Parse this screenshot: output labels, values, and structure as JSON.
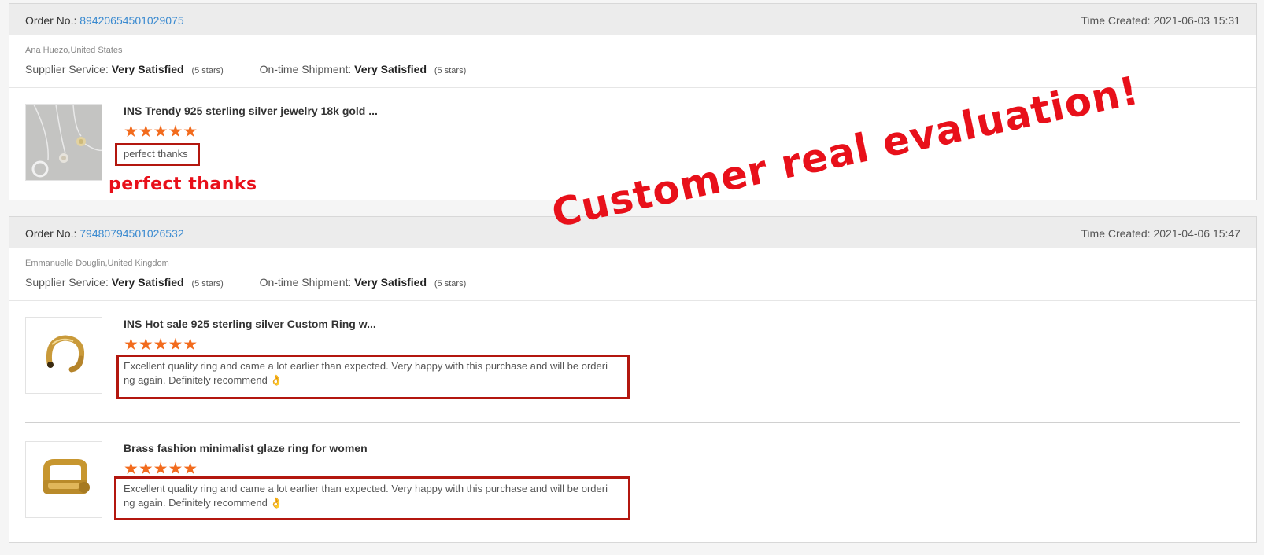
{
  "orders": [
    {
      "order_no_label": "Order No.:",
      "order_no": "89420654501029075",
      "time_created": "Time Created: 2021-06-03 15:31",
      "buyer": "Ana Huezo,United States",
      "supplier_label": "Supplier Service:",
      "supplier_value": "Very Satisfied",
      "supplier_stars": "(5 stars)",
      "shipment_label": "On-time Shipment:",
      "shipment_value": "Very Satisfied",
      "shipment_stars": "(5 stars)",
      "items": [
        {
          "title": "INS Trendy 925 sterling silver jewelry 18k gold ...",
          "rating": 5,
          "stars": "★★★★★",
          "comment": "perfect thanks"
        }
      ]
    },
    {
      "order_no_label": "Order No.:",
      "order_no": "79480794501026532",
      "time_created": "Time Created: 2021-04-06 15:47",
      "buyer": "Emmanuelle Douglin,United Kingdom",
      "supplier_label": "Supplier Service:",
      "supplier_value": "Very Satisfied",
      "supplier_stars": "(5 stars)",
      "shipment_label": "On-time Shipment:",
      "shipment_value": "Very Satisfied",
      "shipment_stars": "(5 stars)",
      "items": [
        {
          "title": "INS Hot sale 925 sterling silver Custom Ring w...",
          "rating": 5,
          "stars": "★★★★★",
          "comment": "Excellent quality ring and came a lot earlier than expected. Very happy with this purchase and will be orderi\nng again. Definitely recommend 👌"
        },
        {
          "title": "Brass fashion minimalist glaze ring for women",
          "rating": 5,
          "stars": "★★★★★",
          "comment": "Excellent quality ring and came a lot earlier than expected. Very happy with this purchase and will be orderi\nng again. Definitely recommend 👌"
        }
      ]
    }
  ],
  "annotations": {
    "perfect_note": "perfect thanks",
    "banner": "Customer real evaluation!"
  },
  "colors": {
    "link": "#3a8ad0",
    "star": "#f26b1d",
    "highlight": "#b3170f",
    "annotation": "#e8101a"
  }
}
